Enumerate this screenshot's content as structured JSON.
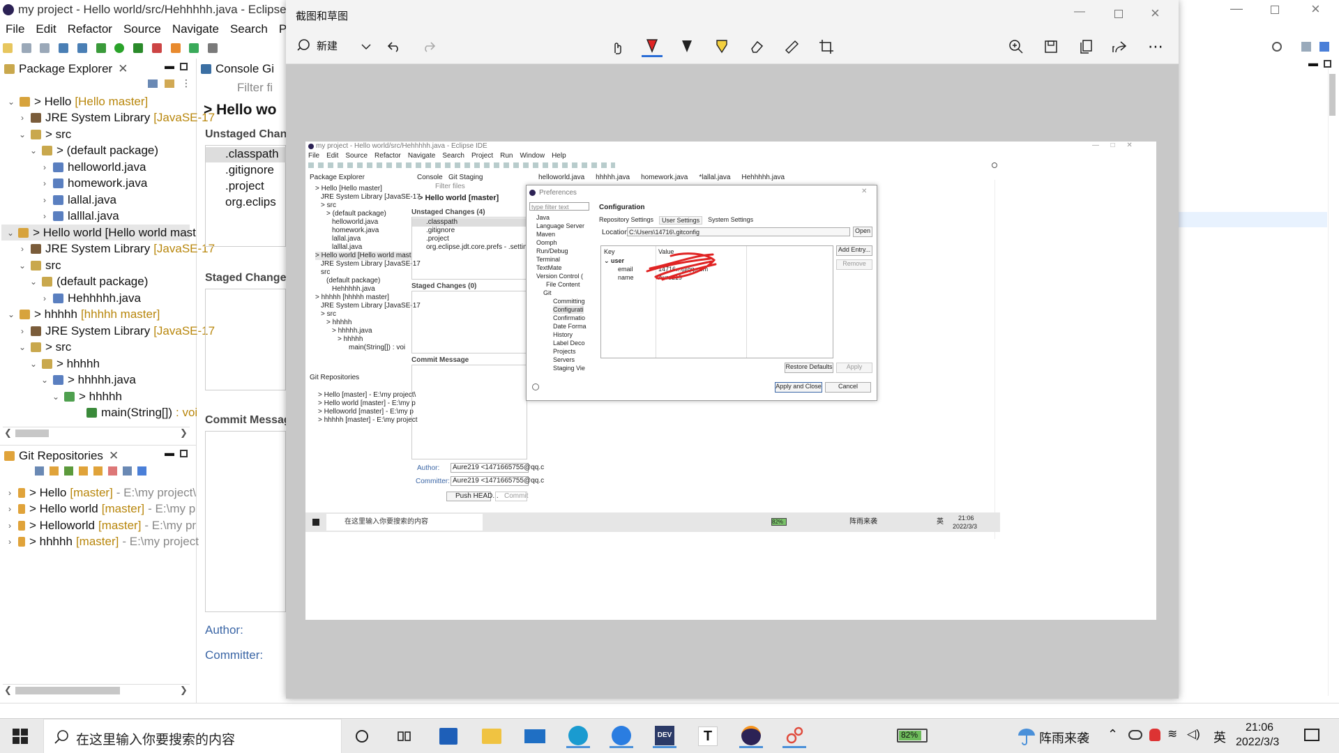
{
  "eclipse": {
    "window_title": "my project - Hello world/src/Hehhhhh.java - Eclipse I",
    "menu": [
      "File",
      "Edit",
      "Refactor",
      "Source",
      "Navigate",
      "Search",
      "Proje"
    ],
    "package_explorer": {
      "tab_label": "Package Explorer",
      "rows": [
        {
          "label": "> Hello",
          "dec": "[Hello master]"
        },
        {
          "label": "JRE System Library",
          "dec": "[JavaSE-17"
        },
        {
          "label": "> src",
          "dec": ""
        },
        {
          "label": "> (default package)",
          "dec": ""
        },
        {
          "label": "helloworld.java",
          "dec": ""
        },
        {
          "label": "homework.java",
          "dec": ""
        },
        {
          "label": "lallal.java",
          "dec": ""
        },
        {
          "label": "lalllal.java",
          "dec": ""
        },
        {
          "label": "> Hello world [Hello world mast",
          "dec": ""
        },
        {
          "label": "JRE System Library",
          "dec": "[JavaSE-17"
        },
        {
          "label": "src",
          "dec": ""
        },
        {
          "label": "(default package)",
          "dec": ""
        },
        {
          "label": "Hehhhhh.java",
          "dec": ""
        },
        {
          "label": "> hhhhh",
          "dec": "[hhhhh master]"
        },
        {
          "label": "JRE System Library",
          "dec": "[JavaSE-17"
        },
        {
          "label": "> src",
          "dec": ""
        },
        {
          "label": "> hhhhh",
          "dec": ""
        },
        {
          "label": "> hhhhh.java",
          "dec": ""
        },
        {
          "label": "> hhhhh",
          "dec": ""
        },
        {
          "label": "main(String[])",
          "dec": ": voi"
        }
      ]
    },
    "git_repos": {
      "tab_label": "Git Repositories",
      "rows": [
        {
          "label": "> Hello",
          "dec": "[master]",
          "path": "- E:\\my project\\"
        },
        {
          "label": "> Hello world",
          "dec": "[master]",
          "path": "- E:\\my p"
        },
        {
          "label": "> Helloworld",
          "dec": "[master]",
          "path": "- E:\\my pr"
        },
        {
          "label": "> hhhhh",
          "dec": "[master]",
          "path": "- E:\\my project"
        }
      ]
    },
    "console_tab": "Console",
    "git_tab": "Gi",
    "filter_placeholder": "Filter fi",
    "staging_header": "> Hello wo",
    "unstaged_label": "Unstaged Chan",
    "unstaged_files": [
      ".classpath",
      ".gitignore",
      ".project",
      "org.eclips"
    ],
    "staged_label": "Staged Change",
    "commit_label": "Commit Messag",
    "author_label": "Author:",
    "committer_label": "Committer:"
  },
  "snip": {
    "title": "截图和草图",
    "new_label": "新建"
  },
  "inner": {
    "window_title": "my project - Hello world/src/Hehhhhh.java - Eclipse IDE",
    "menu": [
      "File",
      "Edit",
      "Source",
      "Refactor",
      "Navigate",
      "Search",
      "Project",
      "Run",
      "Window",
      "Help"
    ],
    "pkg_tab": "Package Explorer",
    "console_tab": "Console",
    "staging_tab": "Git Staging",
    "editor_tabs": [
      "helloworld.java",
      "hhhhh.java",
      "homework.java",
      "*lallal.java",
      "Hehhhhh.java"
    ],
    "filter_placeholder": "Filter files",
    "staging_header": "> Hello world [master]",
    "unstaged_label": "Unstaged Changes (4)",
    "unstaged_files": [
      ".classpath",
      ".gitignore",
      ".project",
      "org.eclipse.jdt.core.prefs - .settings"
    ],
    "staged_label": "Staged Changes (0)",
    "commit_label": "Commit Message",
    "author_label": "Author:",
    "author_value": "Aure219 <1471665755@qq.c",
    "committer_label": "Committer:",
    "committer_value": "Aure219 <1471665755@qq.c",
    "push_label": "Push HEAD...",
    "commit_btn": "Commit",
    "tree_rows": [
      "> Hello [Hello master]",
      "JRE System Library [JavaSE-17",
      "> src",
      "> (default package)",
      "helloworld.java",
      "homework.java",
      "lallal.java",
      "lalllal.java",
      "> Hello world [Hello world mast",
      "JRE System Library [JavaSE-17",
      "src",
      "(default package)",
      "Hehhhhh.java",
      "> hhhhh [hhhhh master]",
      "JRE System Library [JavaSE-17",
      "> src",
      "> hhhhh",
      "> hhhhh.java",
      "> hhhhh",
      "main(String[]) : voi"
    ],
    "git_repos_tab": "Git Repositories",
    "git_repos_rows": [
      "> Hello [master] - E:\\my project\\",
      "> Hello world [master] - E:\\my p",
      "> Helloworld [master] - E:\\my p",
      "> hhhhh [master] - E:\\my project"
    ],
    "taskbar_search": "在这里输入你要搜索的内容",
    "battery": "82%",
    "weather": "阵雨来袭",
    "ime": "英",
    "time": "21:06",
    "date": "2022/3/3"
  },
  "prefs": {
    "title": "Preferences",
    "filter_placeholder": "type filter text",
    "tree": [
      "Java",
      "Language Server",
      "Maven",
      "Oomph",
      "Run/Debug",
      "Terminal",
      "TextMate",
      "Version Control (",
      "File Content",
      "Git",
      "Committing",
      "Configurati",
      "Confirmatio",
      "Date Forma",
      "History",
      "Label Deco",
      "Projects",
      "Servers",
      "Staging Vie"
    ],
    "page_title": "Configuration",
    "tabs": [
      "Repository Settings",
      "User Settings",
      "System Settings"
    ],
    "location_label": "Location:",
    "location_value": "C:\\Users\\14716\\.gitconfig",
    "open_btn": "Open",
    "col_key": "Key",
    "col_value": "Value",
    "rows": [
      {
        "key": "user",
        "value": ""
      },
      {
        "key": "email",
        "value": "14716...@qq.com"
      },
      {
        "key": "name",
        "value": "Aure219"
      }
    ],
    "add_entry": "Add Entry...",
    "remove": "Remove",
    "restore": "Restore Defaults",
    "apply": "Apply",
    "apply_close": "Apply and Close",
    "cancel": "Cancel"
  },
  "taskbar": {
    "search_placeholder": "在这里输入你要搜索的内容",
    "battery": "82%",
    "weather": "阵雨来袭",
    "ime": "英",
    "time": "21:06",
    "date": "2022/3/3"
  },
  "colors": {
    "accent_red": "#e02424",
    "git_decoration": "#b8860b",
    "selection": "#cce4f7"
  }
}
